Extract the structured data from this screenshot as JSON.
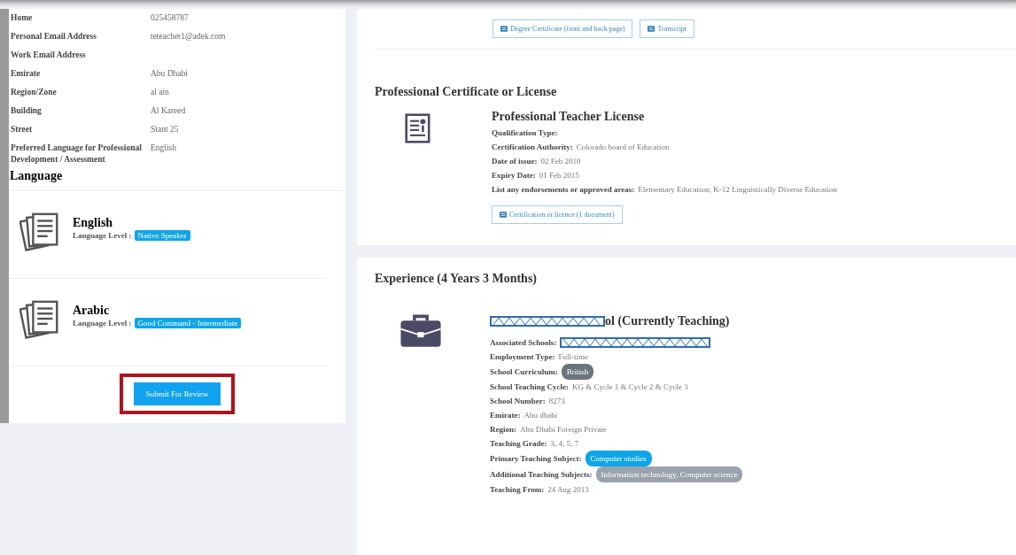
{
  "contact": [
    {
      "label": "Home",
      "value": "025458787"
    },
    {
      "label": "Personal Email Address",
      "value": "teteacher1@adek.com"
    },
    {
      "label": "Work Email Address"
    },
    {
      "label": "Emirate",
      "value": "Abu Dhabi"
    },
    {
      "label": "Region/Zone",
      "value": "al ain"
    },
    {
      "label": "Building",
      "value": "Al Kareed"
    },
    {
      "label": "Street",
      "value": "Stant 25"
    },
    {
      "label": "Preferred Language for Professional Development / Assessment",
      "value": "English"
    }
  ],
  "language": {
    "heading": "Language",
    "items": [
      {
        "name": "English",
        "level_label": "Language Level :",
        "level": "Native Speaker"
      },
      {
        "name": "Arabic",
        "level_label": "Language Level :",
        "level": "Good Command - Intermediate"
      }
    ],
    "submit": "Submit For Review",
    "highlighted": true
  },
  "documents": [
    "Degree Certificate (front and back page)",
    "Transcript"
  ],
  "certificate": {
    "heading": "Professional Certificate or License",
    "title": "Professional Teacher License",
    "fields": [
      {
        "label": "Qualification Type:"
      },
      {
        "label": "Certification Authority:",
        "value": "Colorado board of Education"
      },
      {
        "label": "Date of issue:",
        "value": "02 Feb 2010"
      },
      {
        "label": "Expiry Date:",
        "value": "01 Feb 2015"
      },
      {
        "label": "List any endorsements or approved areas:",
        "value": "Elementary Education; K-12 Linguistically Diverse Education"
      }
    ],
    "document": "Certification or licence (1 document)"
  },
  "experience": {
    "heading": "Experience (4 Years 3 Months)",
    "title": "ol (Currently Teaching)",
    "title_redacted": true,
    "fields": [
      {
        "label": "Associated Schools:",
        "redacted": true
      },
      {
        "label": "Employment Type:",
        "value": "Full-time"
      },
      {
        "label": "School Curriculum:",
        "badges": [
          {
            "text": "British",
            "color": "#6c757d"
          }
        ]
      },
      {
        "label": "School Teaching Cycle:",
        "value": "KG & Cycle 1 & Cycle 2 & Cycle 3"
      },
      {
        "label": "School Number:",
        "value": "8273"
      },
      {
        "label": "Emirate:",
        "value": "Abu dhabi"
      },
      {
        "label": "Region:",
        "value": "Abu Dhabi Foreign Private"
      },
      {
        "label": "Teaching Grade:",
        "value": "3, 4, 5, 7"
      },
      {
        "label": "Primary Teaching Subject:",
        "badges": [
          {
            "text": "Computer studies",
            "color": "#0ea5e9"
          }
        ]
      },
      {
        "label": "Additional Teaching Subjects:",
        "badges": [
          {
            "text": "Information technology, Computer science",
            "color": "#9aa3ad"
          }
        ]
      },
      {
        "label": "Teaching From:",
        "value": "24 Aug 2013"
      }
    ]
  }
}
